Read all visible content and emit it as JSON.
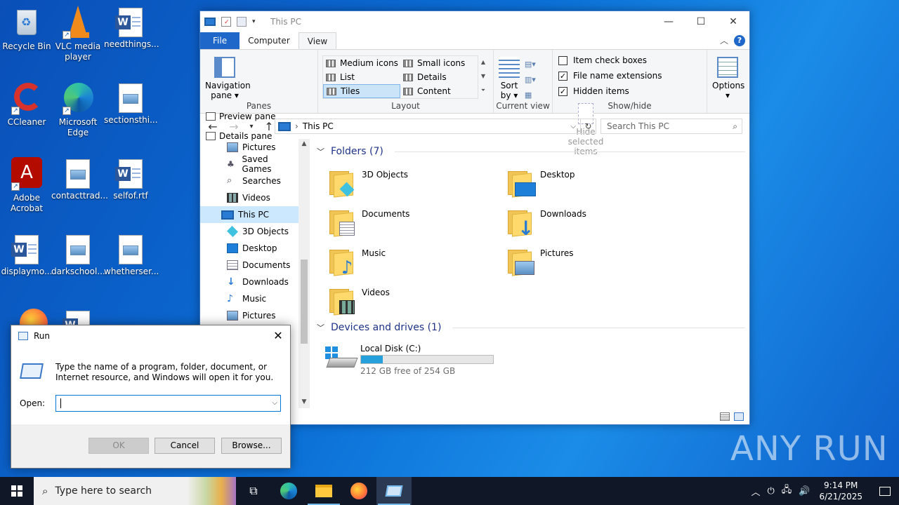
{
  "desktop": {
    "icons": [
      {
        "label": "Recycle Bin"
      },
      {
        "label": "VLC media player"
      },
      {
        "label": "needthings..."
      },
      {
        "label": "CCleaner"
      },
      {
        "label": "Microsoft Edge"
      },
      {
        "label": "sectionsthi..."
      },
      {
        "label": "Adobe Acrobat"
      },
      {
        "label": "contacttrad..."
      },
      {
        "label": "selfof.rtf"
      },
      {
        "label": "displaymo..."
      },
      {
        "label": "darkschool..."
      },
      {
        "label": "whetherser..."
      }
    ],
    "watermark": "ANY RUN"
  },
  "explorer": {
    "title": "This PC",
    "tabs": {
      "file": "File",
      "computer": "Computer",
      "view": "View"
    },
    "ribbon": {
      "panes": {
        "navigation_pane": "Navigation pane",
        "preview_pane": "Preview pane",
        "details_pane": "Details pane",
        "group_label": "Panes"
      },
      "layout": {
        "medium_icons": "Medium icons",
        "small_icons": "Small icons",
        "list": "List",
        "details": "Details",
        "tiles": "Tiles",
        "content": "Content",
        "group_label": "Layout"
      },
      "current_view": {
        "sort_by": "Sort by",
        "group_label": "Current view"
      },
      "show_hide": {
        "item_check_boxes": "Item check boxes",
        "file_name_extensions": "File name extensions",
        "hidden_items": "Hidden items",
        "hide_selected_items": "Hide selected items",
        "group_label": "Show/hide",
        "item_check_boxes_checked": false,
        "file_name_extensions_checked": true,
        "hidden_items_checked": true
      },
      "options": "Options"
    },
    "address": {
      "path": "This PC",
      "search_placeholder": "Search This PC"
    },
    "nav_pane": [
      {
        "label": "Pictures"
      },
      {
        "label": "Saved Games"
      },
      {
        "label": "Searches"
      },
      {
        "label": "Videos"
      },
      {
        "label": "This PC",
        "selected": true
      },
      {
        "label": "3D Objects"
      },
      {
        "label": "Desktop"
      },
      {
        "label": "Documents"
      },
      {
        "label": "Downloads"
      },
      {
        "label": "Music"
      },
      {
        "label": "Pictures"
      }
    ],
    "folders_header": "Folders (7)",
    "folders": [
      {
        "name": "3D Objects"
      },
      {
        "name": "Desktop"
      },
      {
        "name": "Documents"
      },
      {
        "name": "Downloads"
      },
      {
        "name": "Music"
      },
      {
        "name": "Pictures"
      },
      {
        "name": "Videos"
      }
    ],
    "devices_header": "Devices and drives (1)",
    "drive": {
      "name": "Local Disk (C:)",
      "free_text": "212 GB free of 254 GB",
      "used_fraction": 0.165
    }
  },
  "run_dialog": {
    "title": "Run",
    "message": "Type the name of a program, folder, document, or Internet resource, and Windows will open it for you.",
    "open_label": "Open:",
    "open_value": "",
    "ok": "OK",
    "cancel": "Cancel",
    "browse": "Browse..."
  },
  "taskbar": {
    "search_placeholder": "Type here to search",
    "time": "9:14 PM",
    "date": "6/21/2025"
  },
  "colors": {
    "accent": "#1f68c9",
    "selection": "#cce8ff",
    "drive_bar": "#26a0da"
  }
}
